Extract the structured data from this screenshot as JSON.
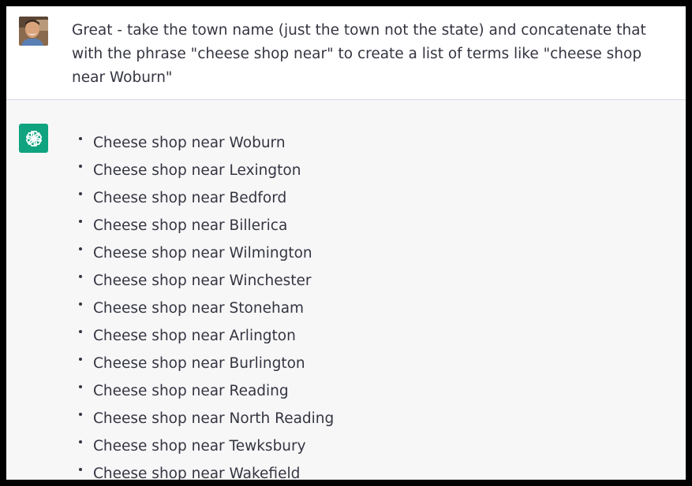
{
  "user_message": {
    "text": "Great - take the town name (just the town not the state) and concatenate that with the phrase \"cheese shop near\" to create a list of terms like \"cheese shop near Woburn\""
  },
  "assistant_message": {
    "items": [
      {
        "text": "Cheese shop near Woburn"
      },
      {
        "text": "Cheese shop near Lexington"
      },
      {
        "text": "Cheese shop near Bedford"
      },
      {
        "text": "Cheese shop near Billerica"
      },
      {
        "text": "Cheese shop near Wilmington"
      },
      {
        "text": "Cheese shop near Winchester"
      },
      {
        "text": "Cheese shop near Stoneham"
      },
      {
        "text": "Cheese shop near Arlington"
      },
      {
        "text": "Cheese shop near Burlington"
      },
      {
        "text": "Cheese shop near Reading"
      },
      {
        "text": "Cheese shop near North Reading"
      },
      {
        "text": "Cheese shop near Tewksbury"
      },
      {
        "text": "Cheese shop near Wakefield"
      }
    ]
  },
  "colors": {
    "page_border": "#000000",
    "user_background": "#ffffff",
    "assistant_background": "#f7f7f8",
    "text": "#343541",
    "assistant_icon": "#10a37f"
  },
  "icons": {
    "user_avatar": "user-avatar-photo",
    "assistant_avatar": "openai-logo-icon"
  }
}
